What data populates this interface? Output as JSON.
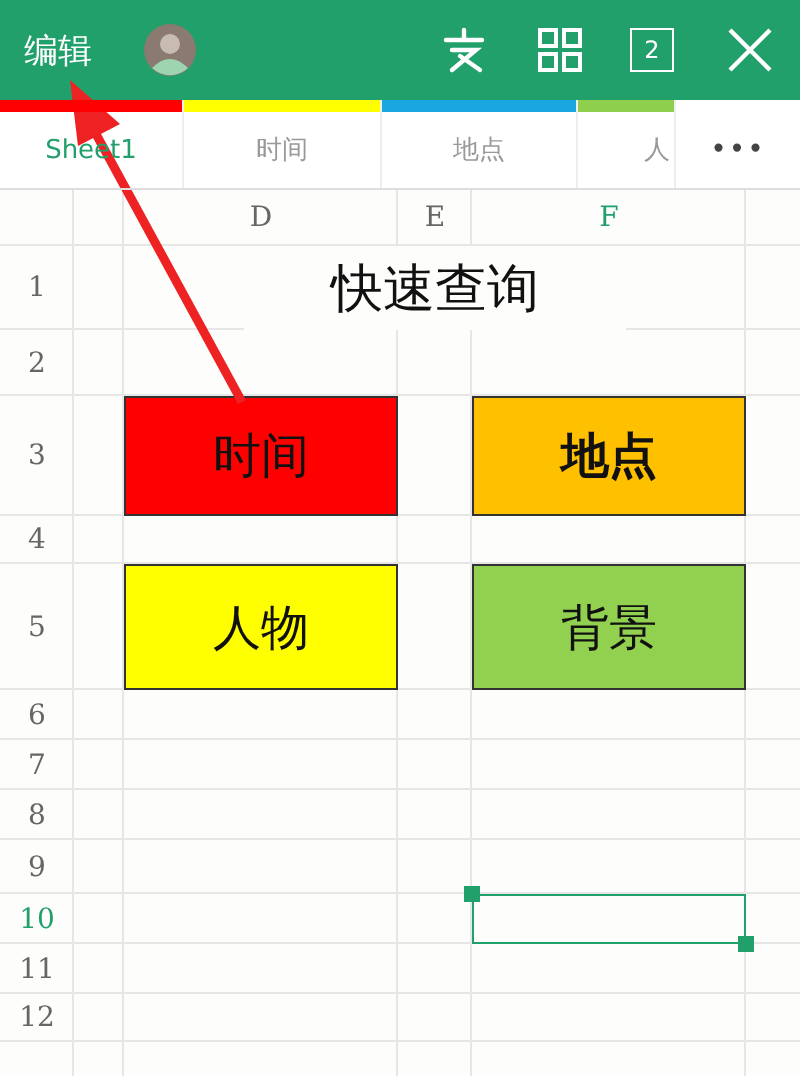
{
  "toolbar": {
    "edit_label": "编辑",
    "window_count": "2"
  },
  "sheet_tabs": [
    {
      "label": "Sheet1",
      "selected": true,
      "color": "#ff0000"
    },
    {
      "label": "时间",
      "selected": false,
      "color": "#ffff00"
    },
    {
      "label": "地点",
      "selected": false,
      "color": "#1aa7e0"
    },
    {
      "label": "人",
      "selected": false,
      "color": "#8fcf4e"
    }
  ],
  "more_button": "•••",
  "columns": [
    {
      "label": "D",
      "selected": false
    },
    {
      "label": "E",
      "selected": false
    },
    {
      "label": "F",
      "selected": true
    }
  ],
  "rows": [
    {
      "label": "1",
      "selected": false
    },
    {
      "label": "2",
      "selected": false
    },
    {
      "label": "3",
      "selected": false
    },
    {
      "label": "4",
      "selected": false
    },
    {
      "label": "5",
      "selected": false
    },
    {
      "label": "6",
      "selected": false
    },
    {
      "label": "7",
      "selected": false
    },
    {
      "label": "8",
      "selected": false
    },
    {
      "label": "9",
      "selected": false
    },
    {
      "label": "10",
      "selected": true
    },
    {
      "label": "11",
      "selected": false
    },
    {
      "label": "12",
      "selected": false
    }
  ],
  "title": "快速查询",
  "buttons": [
    {
      "label": "时间",
      "color": "#ff0000",
      "bold": false
    },
    {
      "label": "地点",
      "color": "#ffc000",
      "bold": true
    },
    {
      "label": "人物",
      "color": "#ffff00",
      "bold": false
    },
    {
      "label": "背景",
      "color": "#92d050",
      "bold": false
    }
  ]
}
